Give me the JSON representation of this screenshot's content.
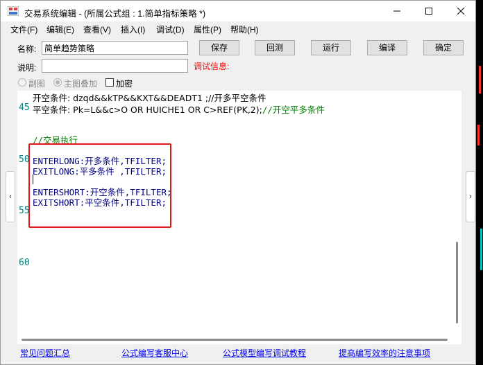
{
  "window": {
    "title": "交易系统编辑 - (所属公式组 : 1.简单指标策略 *)",
    "controls": [
      "minimize-icon",
      "maximize-icon",
      "close-icon"
    ]
  },
  "menu": [
    {
      "label": "文件(F)"
    },
    {
      "label": "编辑(E)"
    },
    {
      "label": "查看(V)"
    },
    {
      "label": "插入(I)"
    },
    {
      "label": "调试(D)"
    },
    {
      "label": "属性(P)"
    },
    {
      "label": "帮助(H)"
    }
  ],
  "form": {
    "name_label": "名称:",
    "name_value": "简单趋势策略",
    "desc_label": "说明:",
    "desc_value": "",
    "debug_label": "调试信息:",
    "buttons": {
      "save": "保存",
      "backtest": "回测",
      "run": "运行",
      "compile": "编译",
      "ok": "确定"
    },
    "options": {
      "sub_chart": "副图",
      "main_overlay": "主图叠加",
      "encrypt": "加密"
    }
  },
  "editor": {
    "line_numbers": [
      "45",
      "50",
      "55",
      "60"
    ],
    "lines": {
      "l44": "开空条件: dzqd&&kTP&&KXT&&DEADT1 ;//开多平空条件",
      "l45_a": "平空条件: Pk=L&&c>O OR HUICHE1 OR C>REF(PK,2);",
      "l45_b": "//开空平多条件",
      "comment_exec": "//交易执行",
      "enterlong_kw": "ENTERLONG",
      "enterlong_rest": ":开多条件,TFILTER;",
      "exitlong_kw": "EXITLONG",
      "exitlong_rest": ":平多条件 ,TFILTER;",
      "entershort_kw": "ENTERSHORT",
      "entershort_rest": ":开空条件,TFILTER;",
      "exitshort_kw": "EXITSHORT",
      "exitshort_rest": ":平空条件,TFILTER;"
    }
  },
  "footer": {
    "links": [
      "常见问题汇总",
      "公式编写客服中心",
      "公式模型编写调试教程",
      "提高编写效率的注意事项"
    ]
  },
  "colors": {
    "highlight_box": "#e01818",
    "comment": "#008000",
    "keyword": "#000080",
    "line_number": "#008080",
    "link": "#0000ee",
    "debug_label": "#ff0000"
  }
}
